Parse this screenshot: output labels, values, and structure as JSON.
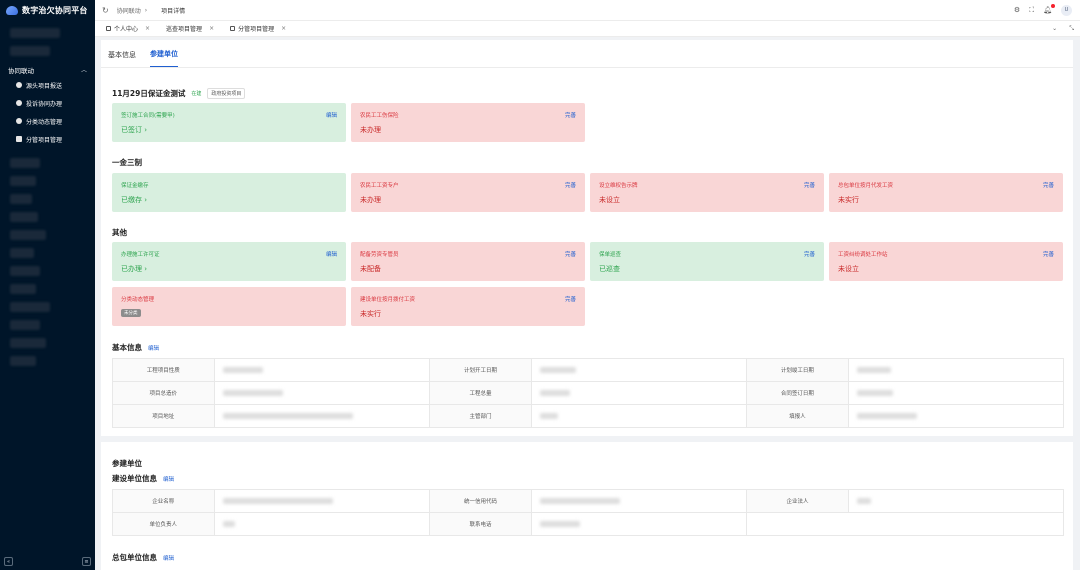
{
  "app": {
    "title": "数字治欠协同平台"
  },
  "sidebar": {
    "group": "协同联动",
    "items": [
      {
        "label": "源头项目报送",
        "icon": "gear-icon"
      },
      {
        "label": "投诉协同办理",
        "icon": "users-icon"
      },
      {
        "label": "分类动态管理",
        "icon": "gear-icon"
      },
      {
        "label": "分管项目管理",
        "icon": "document-icon"
      }
    ]
  },
  "breadcrumb": {
    "parent": "协同联动",
    "current": "项目详情"
  },
  "tabs": [
    {
      "label": "个人中心"
    },
    {
      "label": "巡查项目管理"
    },
    {
      "label": "分管项目管理"
    }
  ],
  "subtabs": {
    "basic": "基本信息",
    "units": "参建单位"
  },
  "project": {
    "title": "11月29日保证金测试",
    "status_tag": "在建",
    "type_tag": "政府投资项目"
  },
  "sections": {
    "yijin": "一金三制",
    "other": "其他",
    "basic_info": "基本信息",
    "units": "参建单位",
    "build_unit": "建设单位信息",
    "general_unit": "总包单位信息",
    "edit": "编辑"
  },
  "cards": {
    "c1": {
      "label": "签订施工合同",
      "sub": "(需要甲)",
      "action": "编辑",
      "status": "已签订"
    },
    "c2": {
      "label": "农民工工伤保险",
      "action": "完善",
      "status": "未办理"
    },
    "c3": {
      "label": "保证金缴存",
      "status": "已缴存"
    },
    "c4": {
      "label": "农民工工资专户",
      "action": "完善",
      "status": "未办理"
    },
    "c5": {
      "label": "设立维权告示牌",
      "action": "完善",
      "status": "未设立"
    },
    "c6": {
      "label": "总包单位按月代发工资",
      "action": "完善",
      "status": "未实行"
    },
    "c7": {
      "label": "办理施工许可证",
      "action": "编辑",
      "status": "已办理"
    },
    "c8": {
      "label": "配备劳资专管员",
      "action": "完善",
      "status": "未配备"
    },
    "c9": {
      "label": "保单巡查",
      "action": "完善",
      "status": "已巡查"
    },
    "c10": {
      "label": "工资纠纷调处工作站",
      "action": "完善",
      "status": "未设立"
    },
    "c11": {
      "label": "分类动态管理",
      "pill": "未分类"
    },
    "c12": {
      "label": "建设单位按月拨付工资",
      "action": "完善",
      "status": "未实行"
    }
  },
  "basic_table": {
    "k1": "工程项目性质",
    "k2": "计划开工日期",
    "k3": "计划竣工日期",
    "k4": "项目总造价",
    "k5": "工程总量",
    "k6": "合同签订日期",
    "k7": "项目地址",
    "k8": "主管部门",
    "k9": "填报人"
  },
  "unit_table": {
    "k1": "企业名称",
    "k2": "统一信用代码",
    "k3": "企业法人",
    "k4": "单位负责人",
    "k5": "联系电话"
  },
  "colors": {
    "brand": "#1f5fd0",
    "sidebar_bg": "#001529",
    "green_card": "#d8efdf",
    "red_card": "#f9d6d6"
  }
}
